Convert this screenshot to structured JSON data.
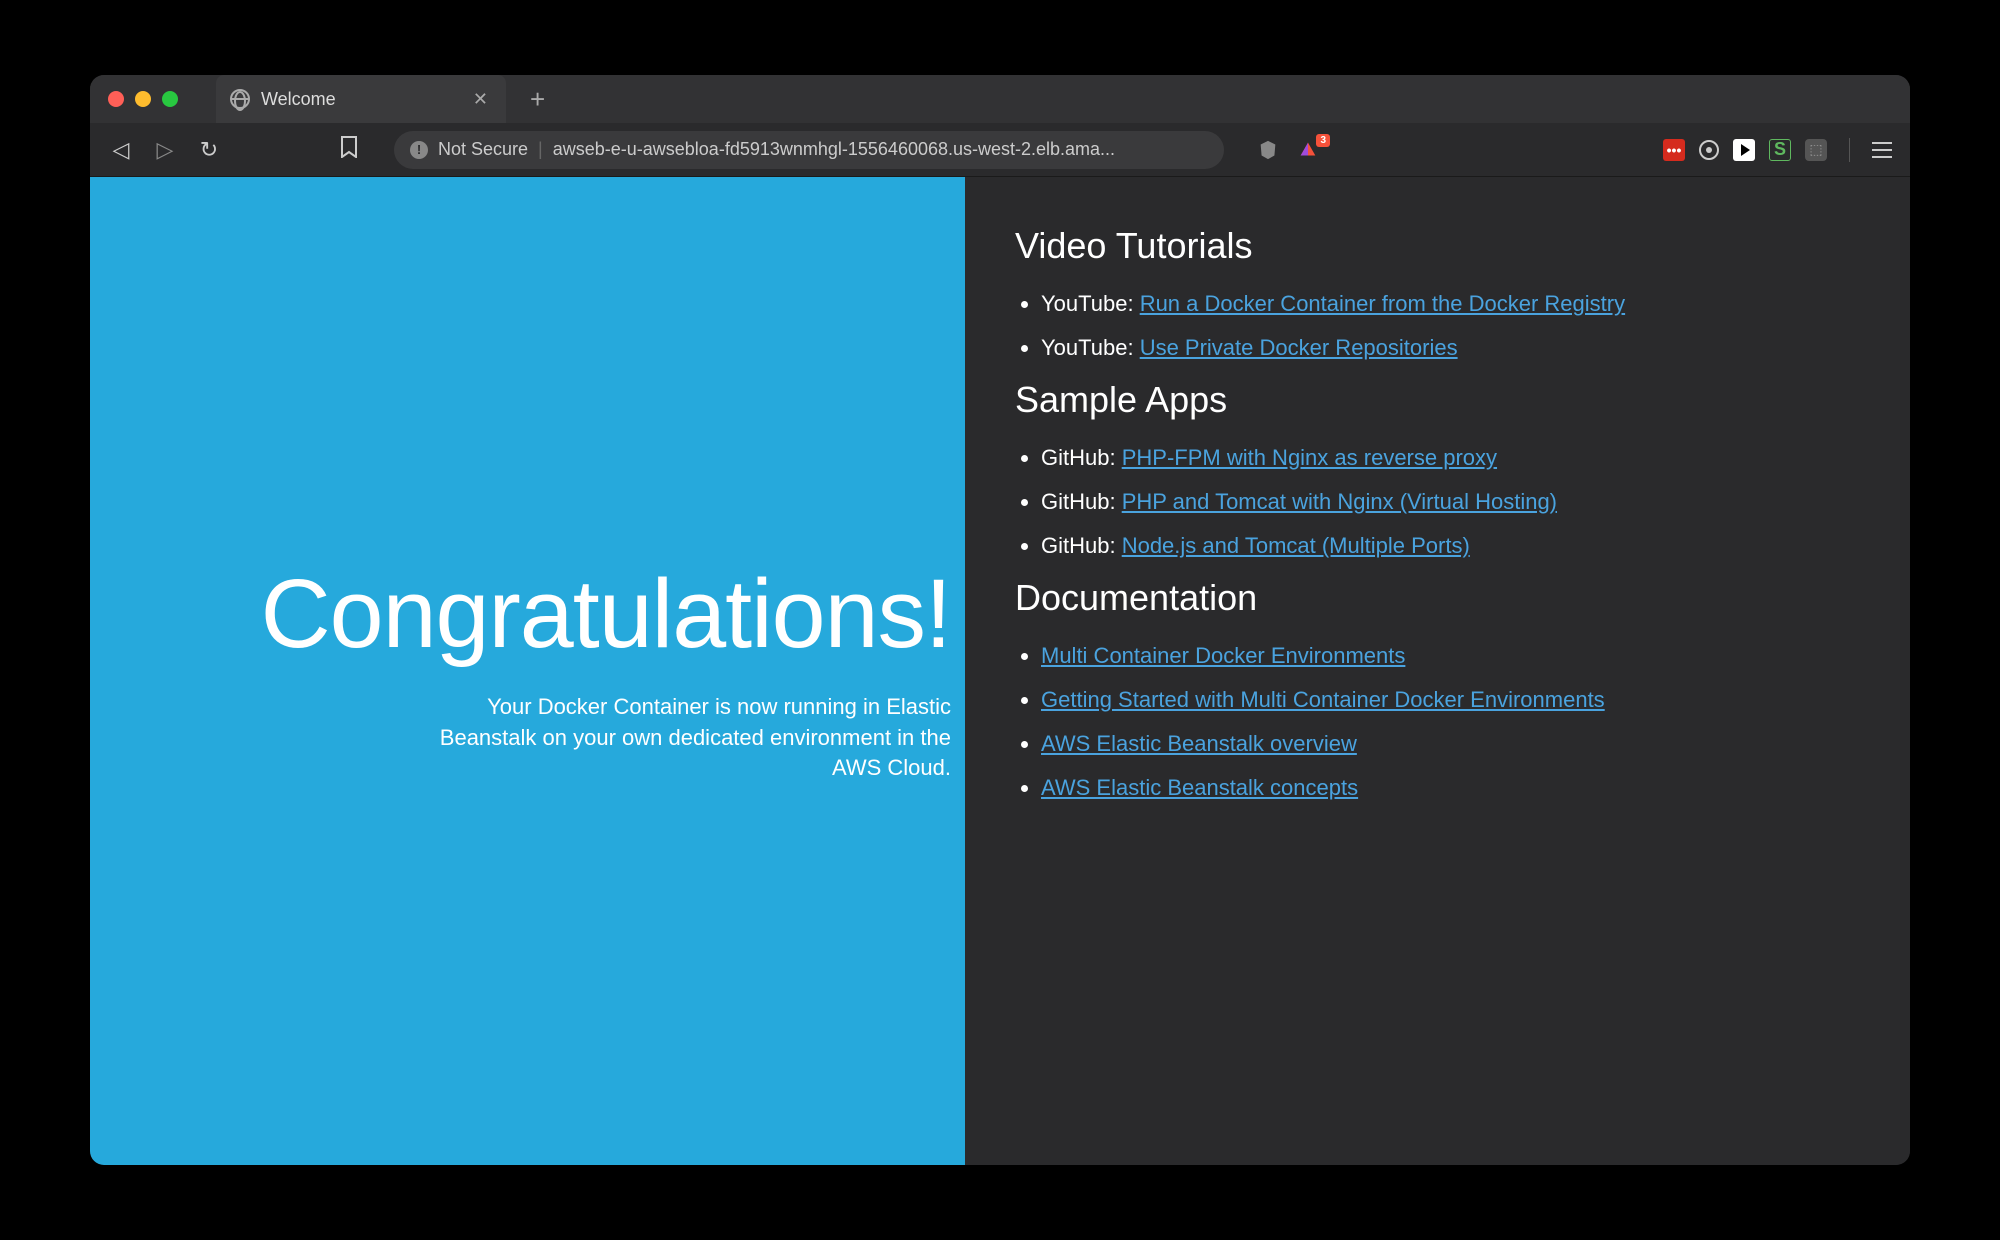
{
  "browser": {
    "tab_title": "Welcome",
    "security_label": "Not Secure",
    "url": "awseb-e-u-awsebloa-fd5913wnmhgl-1556460068.us-west-2.elb.ama...",
    "badge_count": "3"
  },
  "left": {
    "heading": "Congratulations!",
    "subtext": "Your Docker Container is now running in Elastic Beanstalk on your own dedicated environment in the AWS Cloud."
  },
  "sections": [
    {
      "heading": "Video Tutorials",
      "items": [
        {
          "prefix": "YouTube: ",
          "link": "Run a Docker Container from the Docker Registry"
        },
        {
          "prefix": "YouTube: ",
          "link": "Use Private Docker Repositories"
        }
      ]
    },
    {
      "heading": "Sample Apps",
      "items": [
        {
          "prefix": "GitHub: ",
          "link": "PHP-FPM with Nginx as reverse proxy"
        },
        {
          "prefix": "GitHub: ",
          "link": "PHP and Tomcat with Nginx (Virtual Hosting)"
        },
        {
          "prefix": "GitHub: ",
          "link": "Node.js and Tomcat (Multiple Ports)"
        }
      ]
    },
    {
      "heading": "Documentation",
      "items": [
        {
          "prefix": "",
          "link": "Multi Container Docker Environments"
        },
        {
          "prefix": "",
          "link": "Getting Started with Multi Container Docker Environments"
        },
        {
          "prefix": "",
          "link": "AWS Elastic Beanstalk overview"
        },
        {
          "prefix": "",
          "link": "AWS Elastic Beanstalk concepts"
        }
      ]
    }
  ]
}
